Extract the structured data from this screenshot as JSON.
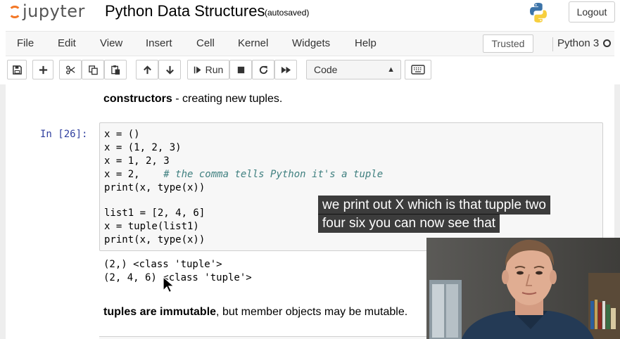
{
  "header": {
    "logo_text": "jupyter",
    "notebook_title": "Python Data Structures",
    "autosave_status": "(autosaved)",
    "logout_label": "Logout"
  },
  "menu": {
    "items": [
      "File",
      "Edit",
      "View",
      "Insert",
      "Cell",
      "Kernel",
      "Widgets",
      "Help"
    ],
    "trusted_label": "Trusted",
    "kernel_name": "Python 3"
  },
  "toolbar": {
    "run_label": "Run",
    "cell_type": "Code",
    "buttons": [
      "save-icon",
      "plus-icon",
      "cut-icon",
      "copy-icon",
      "paste-icon",
      "arrow-up-icon",
      "arrow-down-icon",
      "run-icon",
      "stop-icon",
      "restart-icon",
      "fast-forward-icon",
      "keyboard-icon"
    ]
  },
  "notebook": {
    "md1_bold": "constructors",
    "md1_rest": " - creating new tuples.",
    "prompt": "In [26]:",
    "code_lines": [
      {
        "code": "x = ()",
        "comment": ""
      },
      {
        "code": "x = (1, 2, 3)",
        "comment": ""
      },
      {
        "code": "x = 1, 2, 3",
        "comment": ""
      },
      {
        "code": "x = 2,    ",
        "comment": "# the comma tells Python it's a tuple"
      },
      {
        "code": "print(x, type(x))",
        "comment": ""
      },
      {
        "code": "",
        "comment": ""
      },
      {
        "code": "list1 = [2, 4, 6]",
        "comment": ""
      },
      {
        "code": "x = tuple(list1)",
        "comment": ""
      },
      {
        "code": "print(x, type(x))",
        "comment": ""
      }
    ],
    "output_lines": [
      "(2,) <class 'tuple'>",
      "(2, 4, 6) <class 'tuple'>"
    ],
    "md2_bold": "tuples are immutable",
    "md2_rest": ", but member objects may be mutable."
  },
  "caption": {
    "line1": "we print out X which is that tupple two",
    "line2": "four six you can now see that"
  },
  "colors": {
    "prompt_blue": "#303f9f",
    "comment_green": "#408080",
    "jupyter_orange": "#f37726",
    "cell_bg": "#f7f7f7"
  }
}
